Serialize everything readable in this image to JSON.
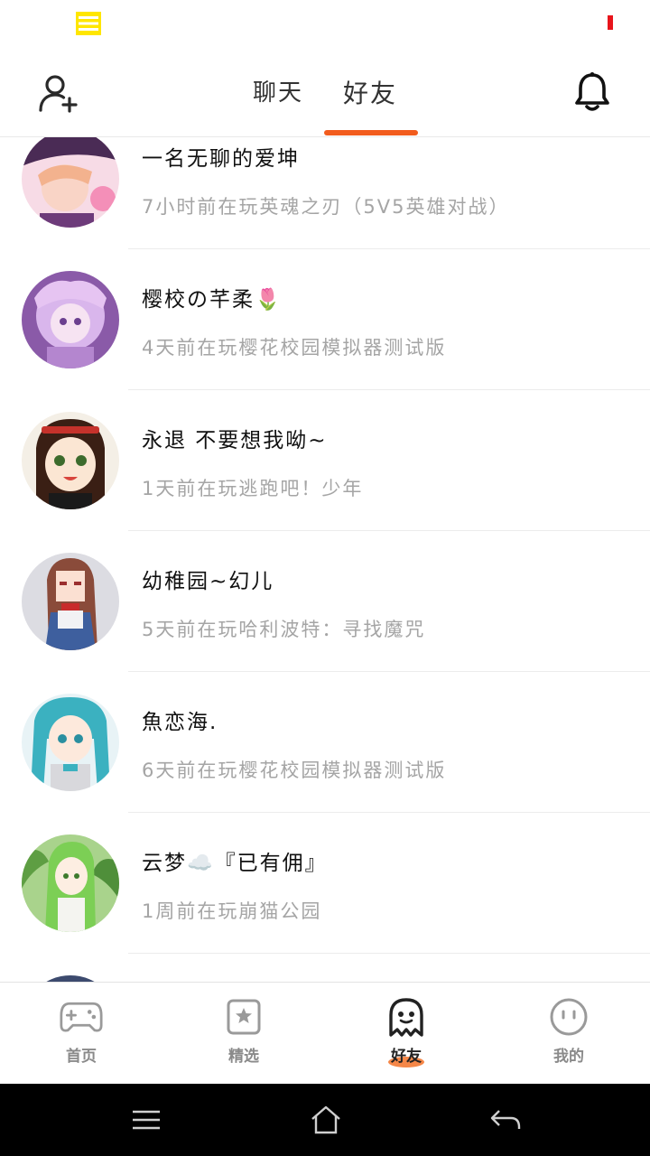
{
  "header": {
    "tabs": [
      {
        "label": "聊天",
        "active": false
      },
      {
        "label": "好友",
        "active": true
      }
    ],
    "accent_color": "#f25c1d"
  },
  "friends": [
    {
      "name": "一名无聊的爱坤",
      "activity": "7小时前在玩英魂之刃（5V5英雄对战）",
      "avatar_colors": [
        "#f4c4d8",
        "#6b3a6e"
      ]
    },
    {
      "name": "樱校の芊柔🌷",
      "activity": "4天前在玩樱花校园模拟器测试版",
      "avatar_colors": [
        "#d7b1e8",
        "#7b4aa0"
      ]
    },
    {
      "name": "永退 不要想我呦~",
      "activity": "1天前在玩逃跑吧！少年",
      "avatar_colors": [
        "#f6e2c8",
        "#3a1f14"
      ]
    },
    {
      "name": "幼稚园~幻儿",
      "activity": "5天前在玩哈利波特：寻找魔咒",
      "avatar_colors": [
        "#e6e6ea",
        "#8a4b3a"
      ]
    },
    {
      "name": "魚恋海.",
      "activity": "6天前在玩樱花校园模拟器测试版",
      "avatar_colors": [
        "#e2f1f4",
        "#3bb1c0"
      ]
    },
    {
      "name": "云梦☁️『已有佣』",
      "activity": "1周前在玩崩猫公园",
      "avatar_colors": [
        "#bfe0a6",
        "#4f8f3a"
      ]
    }
  ],
  "bottom_nav": [
    {
      "label": "首页",
      "icon": "gamepad-icon",
      "active": false
    },
    {
      "label": "精选",
      "icon": "star-card-icon",
      "active": false
    },
    {
      "label": "好友",
      "icon": "ghost-icon",
      "active": true
    },
    {
      "label": "我的",
      "icon": "smiley-icon",
      "active": false
    }
  ],
  "system_bar": {
    "buttons": [
      "menu-icon",
      "home-icon",
      "back-icon"
    ]
  }
}
